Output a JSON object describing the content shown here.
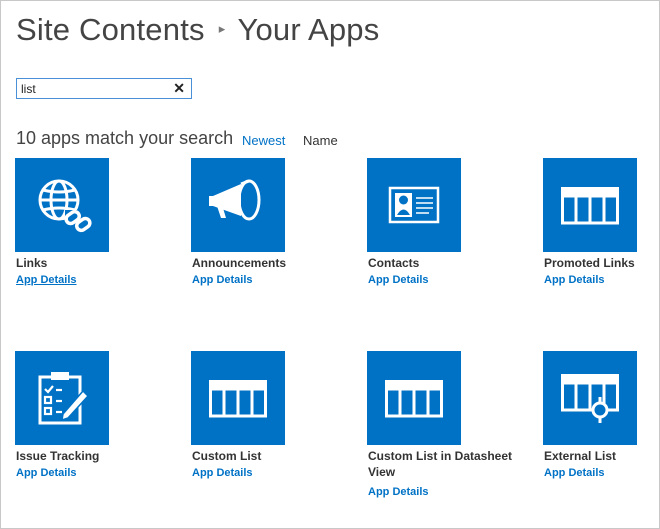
{
  "header": {
    "title_part1": "Site Contents",
    "separator": "▸",
    "title_part2": "Your Apps"
  },
  "search": {
    "value": "list",
    "clear_glyph": "✕"
  },
  "results": {
    "count_text": "10 apps match your search",
    "sort_newest": "Newest",
    "sort_name": "Name"
  },
  "colors": {
    "tile": "#0072c6",
    "link": "#0072c6"
  },
  "apps": [
    {
      "title": "Links",
      "link": "App Details",
      "icon": "globe-link-icon"
    },
    {
      "title": "Announcements",
      "link": "App Details",
      "icon": "megaphone-icon"
    },
    {
      "title": "Contacts",
      "link": "App Details",
      "icon": "contact-card-icon"
    },
    {
      "title": "Promoted Links",
      "link": "App Details",
      "icon": "list-grid-icon"
    },
    {
      "title": "Issue Tracking",
      "link": "App Details",
      "icon": "clipboard-check-icon"
    },
    {
      "title": "Custom List",
      "link": "App Details",
      "icon": "list-grid-icon"
    },
    {
      "title": "Custom List in Datasheet View",
      "link": "App Details",
      "icon": "list-grid-icon"
    },
    {
      "title": "External List",
      "link": "App Details",
      "icon": "external-list-icon"
    }
  ]
}
